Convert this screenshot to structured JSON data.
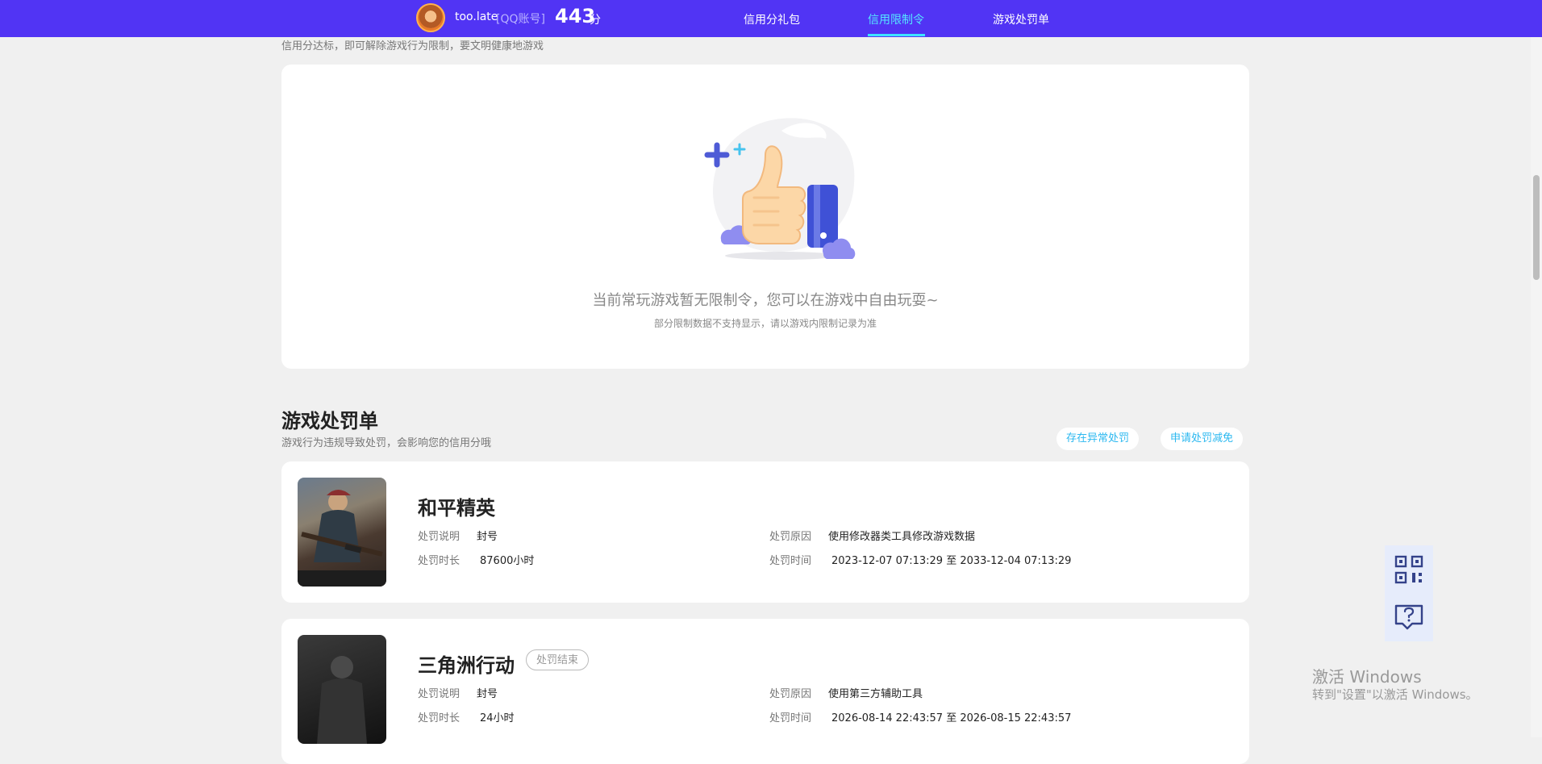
{
  "header": {
    "username": "too.late",
    "account_type": "[QQ账号]",
    "score": "443",
    "score_unit": "分",
    "nav": [
      "信用分礼包",
      "信用限制令",
      "游戏处罚单"
    ]
  },
  "credit": {
    "description": "信用分达标，即可解除游戏行为限制，要文明健康地游戏",
    "empty_title": "当前常玩游戏暂无限制令，您可以在游戏中自由玩耍~",
    "empty_sub": "部分限制数据不支持显示，请以游戏内限制记录为准"
  },
  "punishments": {
    "title": "游戏处罚单",
    "description": "游戏行为违规导致处罚，会影响您的信用分哦",
    "btn_abnormal": "存在异常处罚",
    "btn_reduce": "申请处罚减免",
    "labels": {
      "desc": "处罚说明",
      "duration": "处罚时长",
      "reason": "处罚原因",
      "time": "处罚时间"
    },
    "items": [
      {
        "game": "和平精英",
        "badge": "",
        "desc": "封号",
        "duration": "87600小时",
        "reason": "使用修改器类工具修改游戏数据",
        "time": "2023-12-07 07:13:29 至 2033-12-04 07:13:29"
      },
      {
        "game": "三角洲行动",
        "badge": "处罚结束",
        "desc": "封号",
        "duration": "24小时",
        "reason": "使用第三方辅助工具",
        "time": "2026-08-14 22:43:57 至 2026-08-15 22:43:57"
      }
    ]
  },
  "watermark": {
    "line1": "激活 Windows",
    "line2": "转到\"设置\"以激活 Windows。"
  },
  "colors": {
    "nav_bg": "#5134f4",
    "active": "#55e6ff",
    "link": "#2bb8f0"
  }
}
